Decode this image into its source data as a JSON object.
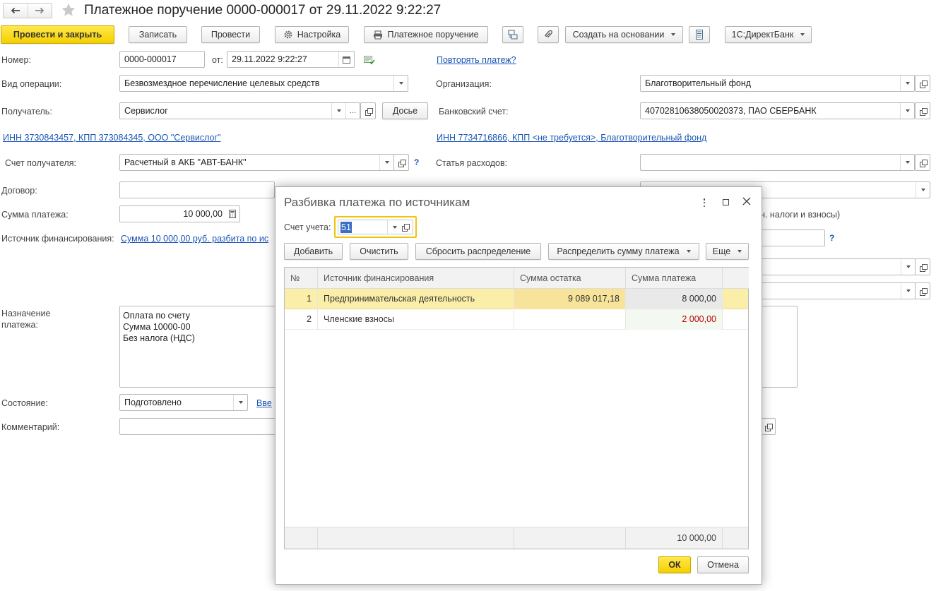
{
  "window": {
    "title": "Платежное поручение 0000-000017 от 29.11.2022 9:22:27"
  },
  "toolbar": {
    "post_close": "Провести и закрыть",
    "save": "Записать",
    "post": "Провести",
    "settings": "Настройка",
    "print_order": "Платежное поручение",
    "create_based": "Создать на основании",
    "directbank": "1С:ДиректБанк"
  },
  "form": {
    "number_label": "Номер:",
    "number_value": "0000-000017",
    "date_label": "от:",
    "date_value": "29.11.2022  9:22:27",
    "repeat_link": "Повторять платеж?",
    "op_type_label": "Вид операции:",
    "op_type_value": "Безвозмездное перечисление целевых средств",
    "org_label": "Организация:",
    "org_value": "Благотворительный фонд",
    "recipient_label": "Получатель:",
    "recipient_value": "Сервислог",
    "dossier": "Досье",
    "bank_account_label": "Банковский счет:",
    "bank_account_value": "40702810638050020373, ПАО СБЕРБАНК",
    "recipient_inn_link": "ИНН 3730843457, КПП 373084345, ООО \"Сервислог\"",
    "org_inn_link": "ИНН 7734716866, КПП <не требуется>, Благотворительный фонд",
    "recipient_account_label": "Счет получателя:",
    "recipient_account_value": "Расчетный в АКБ \"АВТ-БАНК\"",
    "question_mark": "?",
    "expense_item_label": "Статья расходов:",
    "expense_item_value": "",
    "contract_label": "Договор:",
    "contract_value": "",
    "amount_label": "Сумма платежа:",
    "amount_value": "10 000,00",
    "taxes_hint": ".ч. налоги и взносы)",
    "funding_label": "Источник финансирования:",
    "funding_link": "Сумма 10 000,00 руб. разбита по ис",
    "purpose_label_1": "Назначение",
    "purpose_label_2": "платежа:",
    "purpose_line_1": "Оплата по счету",
    "purpose_line_2": "Сумма 10000-00",
    "purpose_line_3": "Без налога (НДС)",
    "state_label": "Состояние:",
    "state_value": "Подготовлено",
    "state_link": "Вве",
    "comment_label": "Комментарий:",
    "comment_value": ""
  },
  "dialog": {
    "title": "Разбивка платежа по источникам",
    "account_label": "Счет учета:",
    "account_value": "51",
    "add": "Добавить",
    "clear": "Очистить",
    "reset": "Сбросить распределение",
    "distribute": "Распределить сумму платежа",
    "more": "Еще",
    "columns": [
      "№",
      "Источник финансирования",
      "Сумма остатка",
      "Сумма платежа"
    ],
    "rows": [
      {
        "num": "1",
        "source": "Предпринимательская деятельность",
        "balance": "9 089 017,18",
        "payment": "8 000,00"
      },
      {
        "num": "2",
        "source": "Членские взносы",
        "balance": "",
        "payment": "2 000,00"
      }
    ],
    "total": "10 000,00",
    "ok": "ОК",
    "cancel": "Отмена"
  },
  "colors": {
    "accent_yellow": "#f5cf00",
    "link_blue": "#1c56b4",
    "row_selected": "#fbeea9",
    "negative_red": "#c00000"
  }
}
